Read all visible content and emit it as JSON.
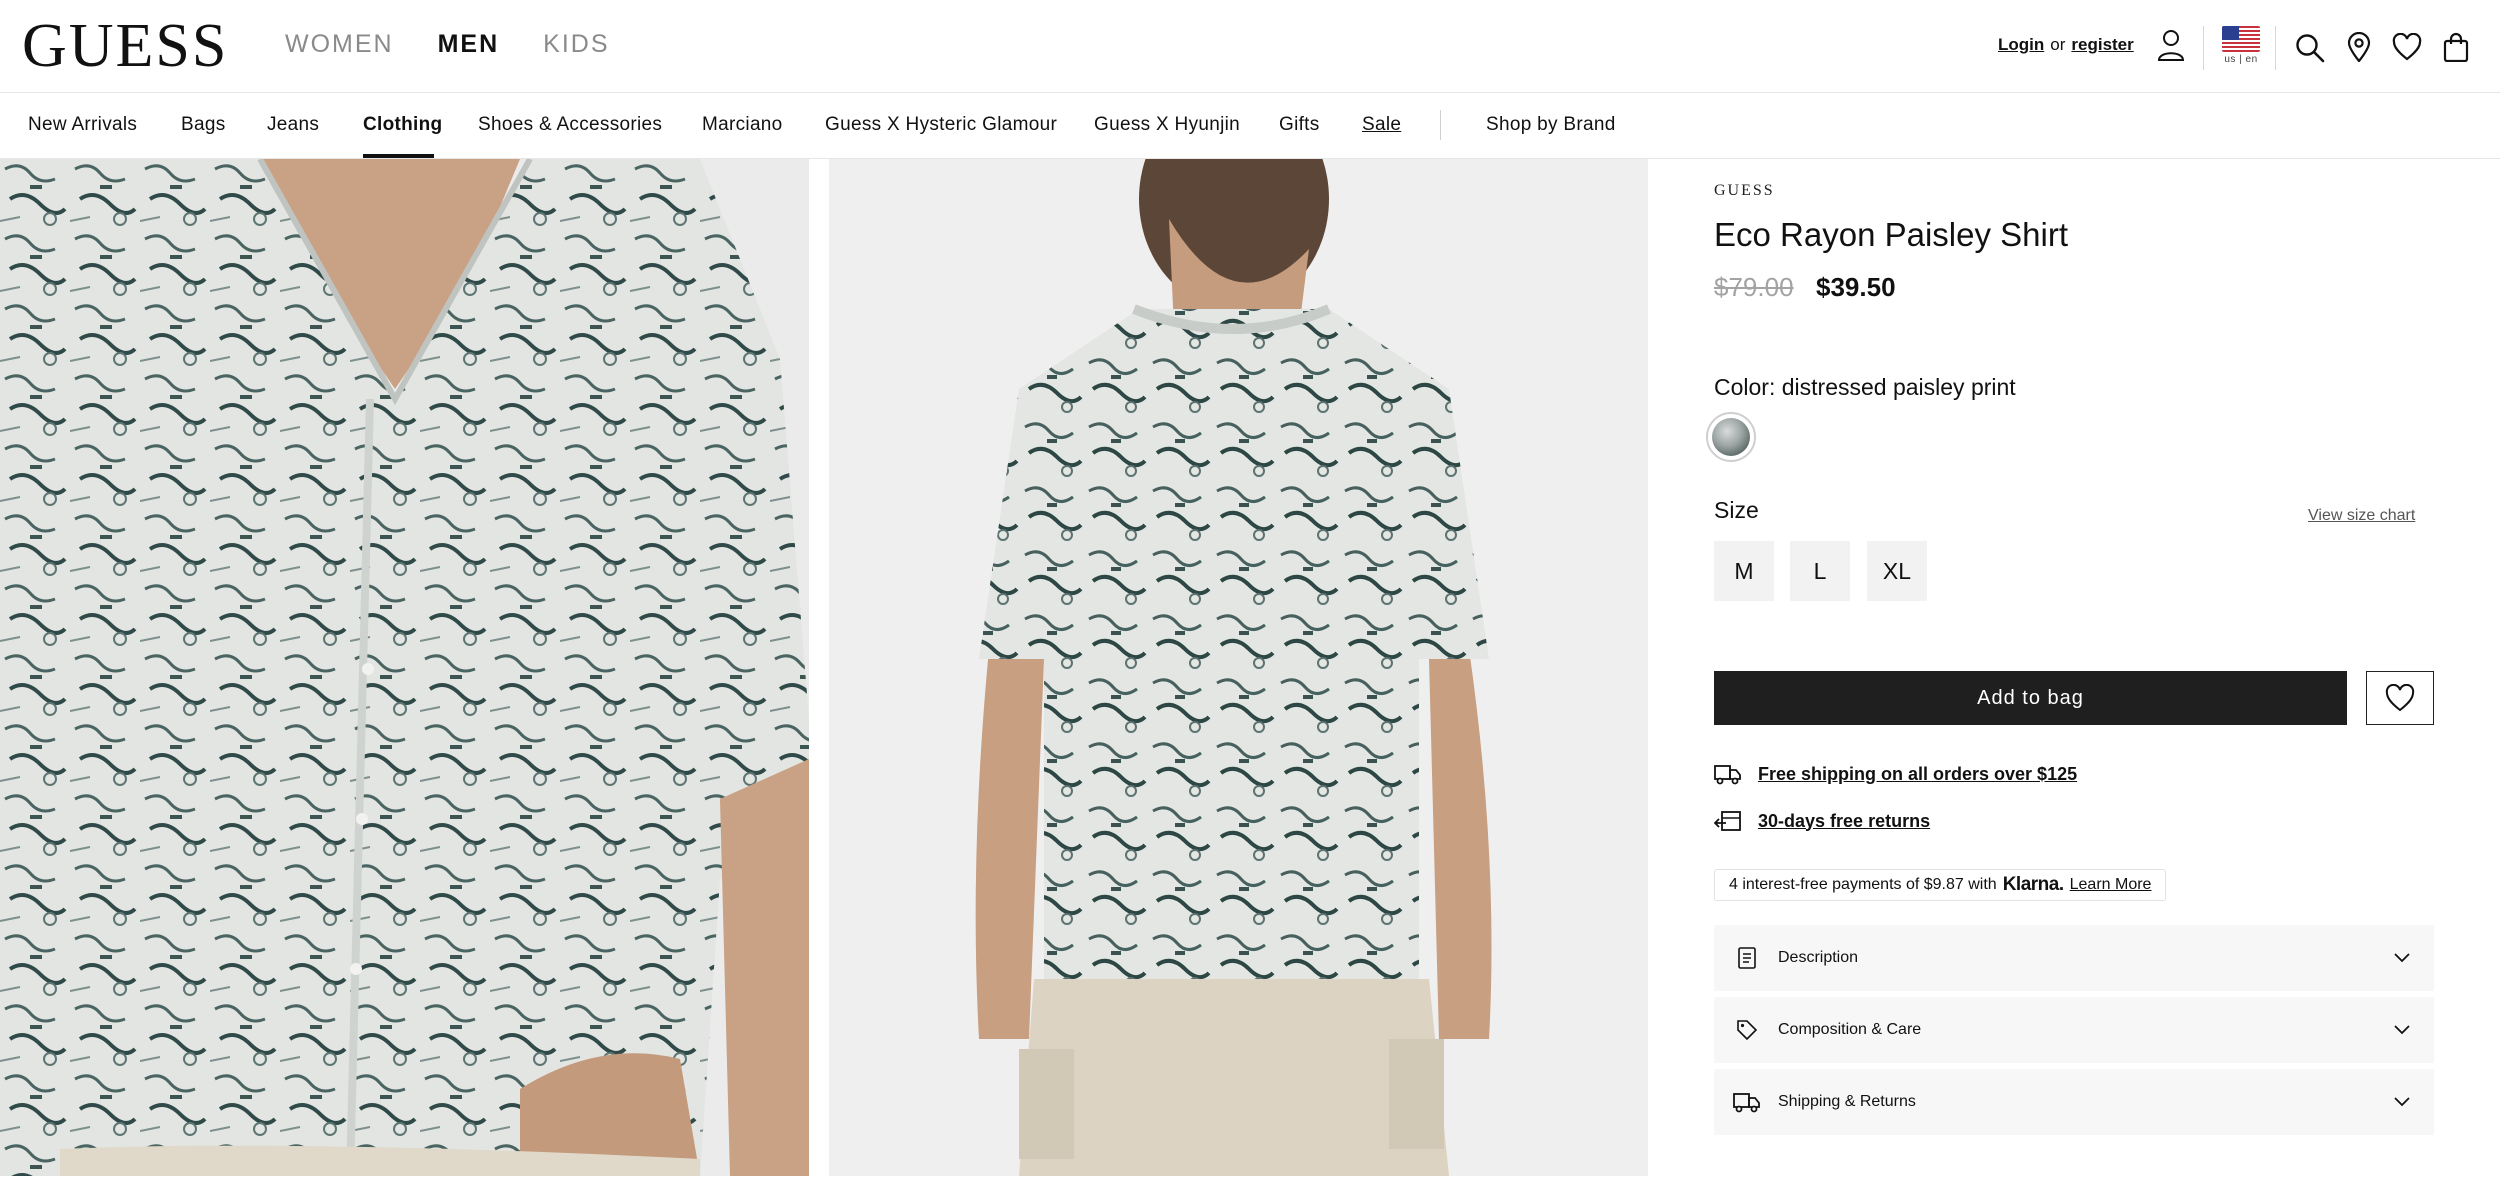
{
  "header": {
    "logo": "GUESS",
    "gender_tabs": [
      {
        "label": "WOMEN",
        "active": false
      },
      {
        "label": "MEN",
        "active": true
      },
      {
        "label": "KIDS",
        "active": false
      }
    ],
    "account": {
      "login": "Login",
      "or": "or",
      "register": "register"
    },
    "locale": "us | en",
    "icons": [
      "account-icon",
      "us-flag-icon",
      "search-icon",
      "store-locator-icon",
      "wishlist-icon",
      "shopping-bag-icon"
    ]
  },
  "category_nav": {
    "items": [
      "New Arrivals",
      "Bags",
      "Jeans",
      "Clothing",
      "Shoes & Accessories",
      "Marciano",
      "Guess X Hysteric Glamour",
      "Guess X Hyunjin",
      "Gifts",
      "Sale"
    ],
    "active": "Clothing",
    "shop_by_brand": "Shop by Brand"
  },
  "product": {
    "brand": "GUESS",
    "title": "Eco Rayon Paisley Shirt",
    "price_original": "$79.00",
    "price_sale": "$39.50",
    "color_label": "Color: distressed paisley print",
    "size_label": "Size",
    "size_chart_link": "View size chart",
    "sizes": [
      "M",
      "L",
      "XL"
    ],
    "add_to_bag": "Add to bag",
    "perks": [
      {
        "icon": "delivery-truck-icon",
        "label": "Free shipping on all orders over $125"
      },
      {
        "icon": "returns-box-icon",
        "label": "30-days free returns"
      }
    ],
    "klarna": {
      "text": "4 interest-free payments of $9.87 with",
      "brand": "Klarna.",
      "learn_more": "Learn More"
    },
    "accordions": [
      {
        "icon": "document-icon",
        "label": "Description"
      },
      {
        "icon": "tag-icon",
        "label": "Composition & Care"
      },
      {
        "icon": "delivery-truck-icon",
        "label": "Shipping & Returns"
      }
    ]
  },
  "colors": {
    "primary_button": "#1f1f1f",
    "flag_blue": "#2a3f8f",
    "flag_red": "#c8313e"
  }
}
